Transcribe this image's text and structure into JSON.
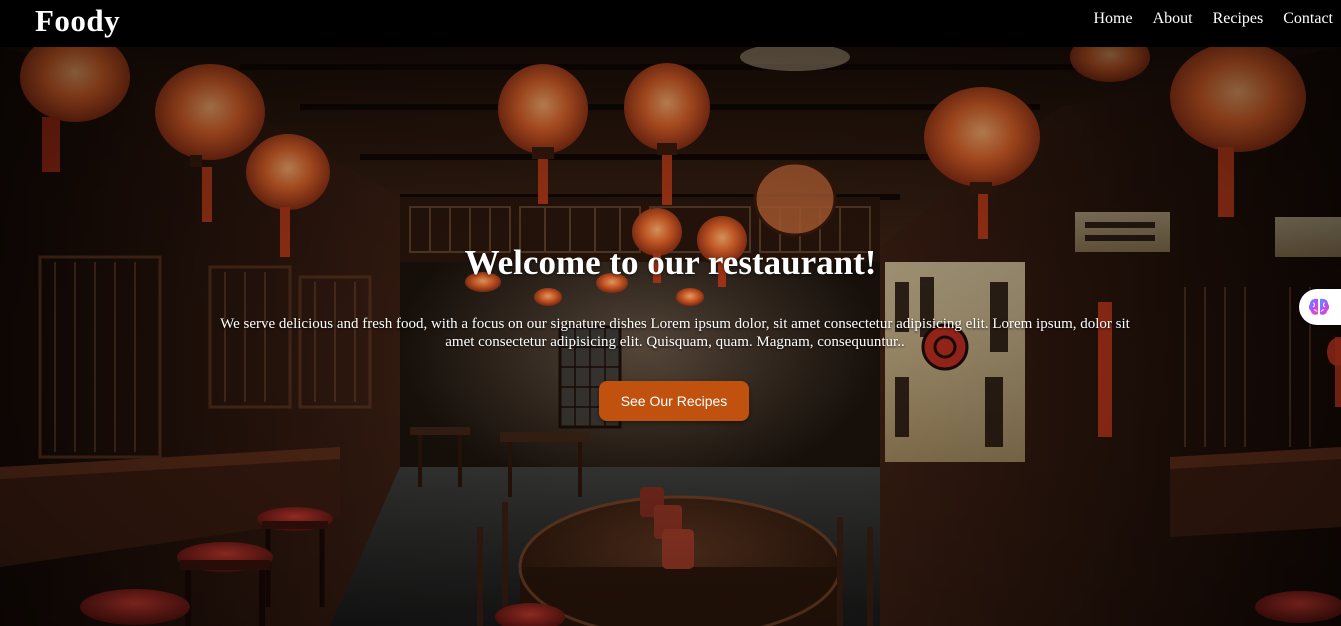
{
  "navbar": {
    "brand": "Foody",
    "links": [
      {
        "label": "Home"
      },
      {
        "label": "About"
      },
      {
        "label": "Recipes"
      },
      {
        "label": "Contact"
      }
    ]
  },
  "hero": {
    "title": "Welcome to our restaurant!",
    "description": "We serve delicious and fresh food, with a focus on our signature dishes Lorem ipsum dolor, sit amet consectetur adipisicing elit. Lorem ipsum, dolor sit amet consectetur adipisicing elit. Quisquam, quam. Magnam, consequuntur..",
    "cta_label": "See Our Recipes",
    "background_icon": "restaurant-interior-photo"
  },
  "widget": {
    "icon": "brain-icon"
  },
  "colors": {
    "navbar_bg": "#000000",
    "cta_bg": "#c0510e",
    "text": "#ffffff",
    "lantern": "#e0622a"
  }
}
